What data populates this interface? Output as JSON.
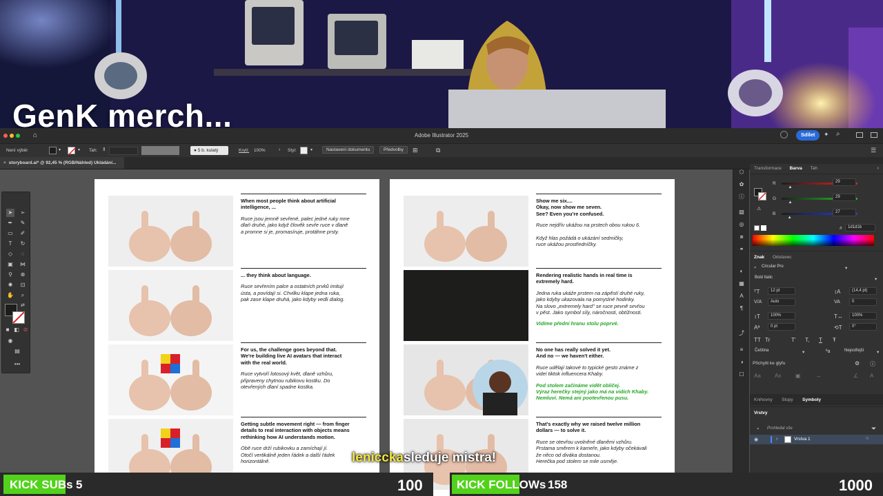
{
  "stream": {
    "overlay_title": "GenK merch...",
    "chat_user": "lenicckа",
    "chat_text": "sleduje mistra!",
    "subs_label": "KICK SUBs",
    "subs_count": "5",
    "subs_goal": "100",
    "subs_progress": 0.05,
    "follows_label": "KICK FOLLOWs",
    "follows_count": "158",
    "follows_goal": "1000",
    "follows_progress": 0.158,
    "green": "#52d21b"
  },
  "app": {
    "title": "Adobe Illustrator 2025",
    "share_button": "Sdílet",
    "control": {
      "selection": "Není výběr",
      "stroke_label": "Tah:",
      "brush": "5 b. kulatý",
      "opacity_label": "Krytí:",
      "opacity_value": "100%",
      "style_label": "Styl:",
      "doc_setup": "Nastavení dokumentu",
      "preferences": "Předvolby"
    },
    "doc_tab": "storyboard.ai* @ 92,45 % (RGB/Náhled) Ukládání..."
  },
  "panel": {
    "tabs": [
      "Transformace",
      "Barva",
      "Tah"
    ],
    "active_tab": "Barva",
    "color": {
      "r_label": "R",
      "r_value": "29",
      "r": 29,
      "g_label": "G",
      "g_value": "29",
      "g": 29,
      "b_label": "B",
      "b_value": "27",
      "b": 27,
      "hex_label": "#",
      "hex": "1d1d1b"
    },
    "char_tabs": [
      "Znak",
      "Odstavec"
    ],
    "font": "Circular Pro",
    "style": "Bold Italic",
    "size": "12 pt",
    "leading": "(14,4 pt)",
    "kerning": "Auto",
    "tracking": "0",
    "v_scale": "100%",
    "h_scale": "100%",
    "baseline": "0 pt",
    "rotation": "0°",
    "tt1": "TT",
    "tt2": "Tr",
    "tt3": "T'",
    "tt4": "T,",
    "tt5": "T",
    "tt6": "Ŧ",
    "language": "Čeština",
    "aa": "Nejostřejší",
    "snap_label": "Přichytit ke glyfu",
    "lib_tabs": [
      "Knihovny",
      "Stopy",
      "Symboly"
    ],
    "layers_title": "Vrstvy",
    "layers_search": "Prohledat vše",
    "layer_name": "Vrstva 1"
  },
  "storyboard": {
    "left": [
      {
        "head": "When most people think about artificial\nintelligence, ...",
        "body": "Ruce jsou jemně sevřené, palec jedné ruky mne\ndlaň druhé, jako když člověk sevře ruce v dlaně\na promne si je, promasíruje, protáhne prsty.",
        "green": ""
      },
      {
        "head": "... they think about language.",
        "body": "Ruce sevřením palce a ostatních prvků imitují\nústa, a povídají si. Chvilku klape jedna ruka,\npak zase klape druhá, jako kdyby vedli dialog.",
        "green": ""
      },
      {
        "head": "For us, the challenge goes beyond that.\nWe're building live AI avatars that interact\nwith the real world.",
        "body": "Ruce vytvoří lotosový květ, dlaně vzhůru,\npřipraveny chytnou rubikovu kostku. Do\notevřených dlaní spadne kostka.",
        "green": ""
      },
      {
        "head": "Getting subtle movement right — from finger\ndetails to real interaction with objects means\nrethinking how AI understands motion.",
        "body": "Obě ruce drží rubikovku a zamíchají jí.\nOtočí vertikálně jeden řádek a další řádek\nhorizontálně.",
        "green": ""
      }
    ],
    "right": [
      {
        "head": "Show me six....\nOkay, now show me seven.\nSee? Even you're confused.",
        "body": "Ruce nejdřív ukážou na prstech obou rukou 6.\n\nKdyž hlas požádá o ukázání sedmičky,\nruce ukážou prostředníčky.",
        "green": ""
      },
      {
        "head": "Rendering realistic hands in real time is\nextremely hard.",
        "body": "Jedna ruka ukáže prstem na zápěstí druhé ruky,\njako kdyby ukazovala na pomyslné hodinky.\nNa slovo „extremely hard\" se ruce pevně sevřou\nv pěst. Jako symbol síly, náročnosti, obtížnosti.",
        "green": "Vidíme přední hranu stolu poprvé."
      },
      {
        "head": "No one has really solved it yet.\nAnd no — we haven't either.",
        "body": "Ruce udělají takové to typické gesto známe z\nvideí tiktok influencera Khaby.",
        "green": "Pod stolem začínáme vidět obličej.\nVýraz herečky stejný jako má na vidích Khaby.\nNemluví. Nemá ani pootevřenou pusu."
      },
      {
        "head": "That's exactly why we raised twelve million\ndollars — to solve it.",
        "body": "Ruce se otevřou uvolněné dlaněmi vzhůru.\nPrstama směrem k kameře, jako kdyby očekávali\nže něco od diváka dostanou.\nHerečka pod stolem se mile usměje.",
        "green": ""
      }
    ]
  }
}
